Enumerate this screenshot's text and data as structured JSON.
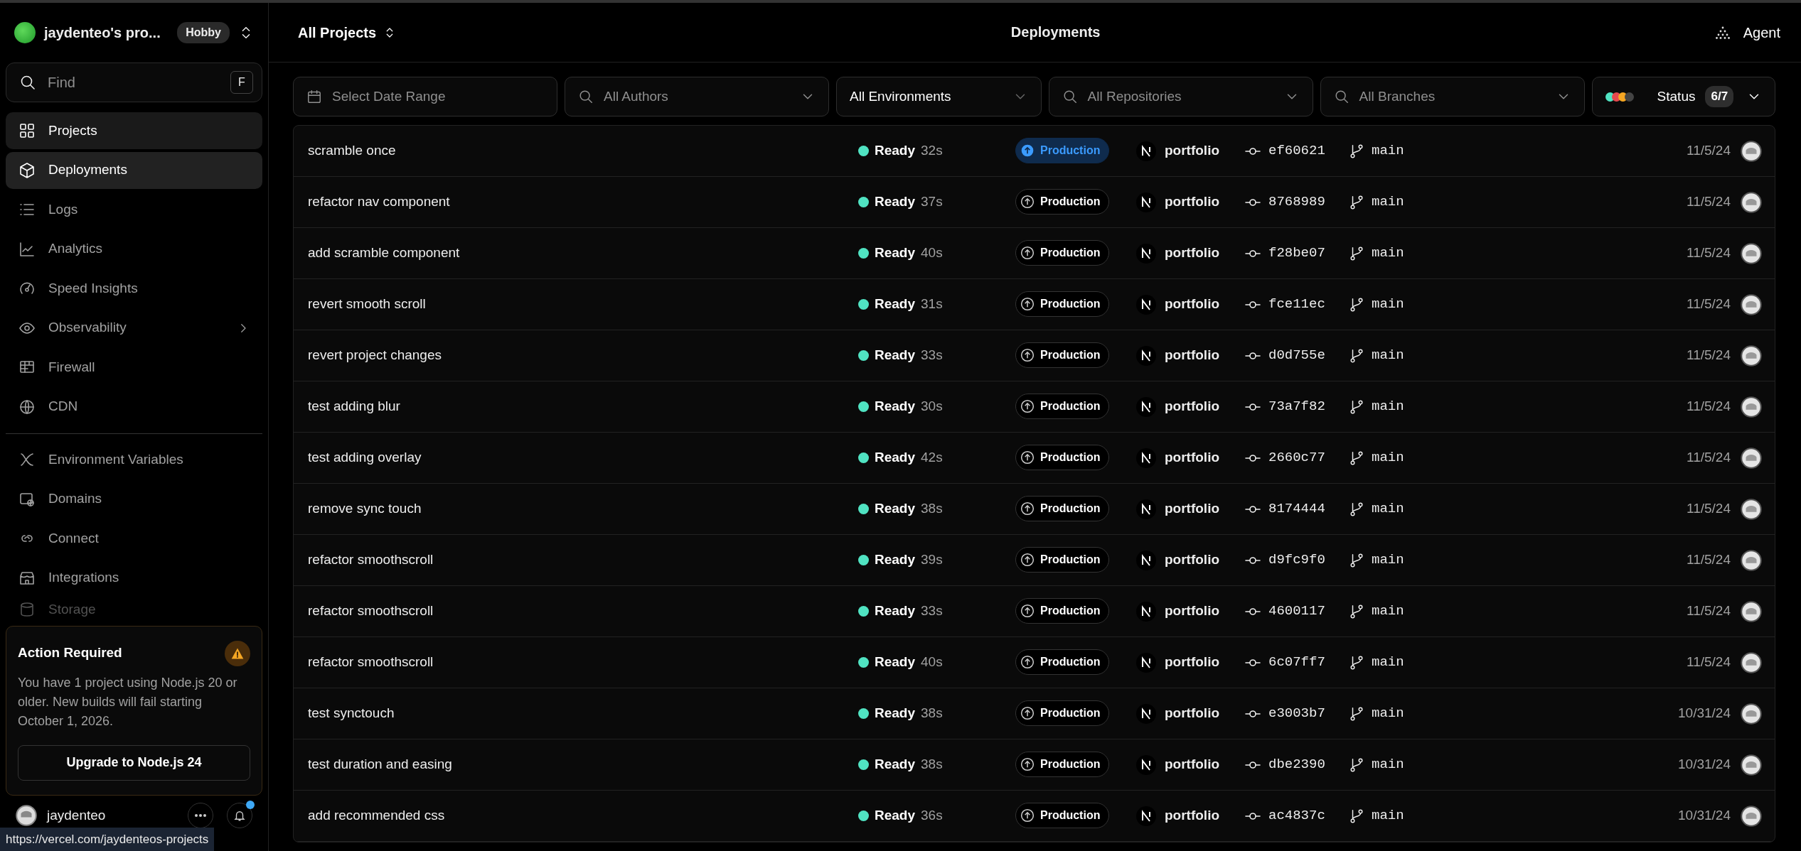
{
  "sidebar": {
    "workspace": "jaydenteo's pro...",
    "plan": "Hobby",
    "search": {
      "placeholder": "Find",
      "shortcut": "F"
    },
    "groups": [
      [
        {
          "label": "Projects",
          "selected": false,
          "hovered": true,
          "has_submenu": false,
          "faded": false
        },
        {
          "label": "Deployments",
          "selected": true,
          "hovered": false,
          "has_submenu": false,
          "faded": false
        },
        {
          "label": "Logs",
          "selected": false,
          "hovered": false,
          "has_submenu": false,
          "faded": false
        },
        {
          "label": "Analytics",
          "selected": false,
          "hovered": false,
          "has_submenu": false,
          "faded": false
        },
        {
          "label": "Speed Insights",
          "selected": false,
          "hovered": false,
          "has_submenu": false,
          "faded": false
        },
        {
          "label": "Observability",
          "selected": false,
          "hovered": false,
          "has_submenu": true,
          "faded": false
        },
        {
          "label": "Firewall",
          "selected": false,
          "hovered": false,
          "has_submenu": false,
          "faded": false
        },
        {
          "label": "CDN",
          "selected": false,
          "hovered": false,
          "has_submenu": false,
          "faded": false
        }
      ],
      [
        {
          "label": "Environment Variables",
          "selected": false,
          "hovered": false,
          "has_submenu": false,
          "faded": false
        },
        {
          "label": "Domains",
          "selected": false,
          "hovered": false,
          "has_submenu": false,
          "faded": false
        },
        {
          "label": "Connect",
          "selected": false,
          "hovered": false,
          "has_submenu": false,
          "faded": false
        },
        {
          "label": "Integrations",
          "selected": false,
          "hovered": false,
          "has_submenu": false,
          "faded": false
        },
        {
          "label": "Storage",
          "selected": false,
          "hovered": false,
          "has_submenu": false,
          "faded": true
        }
      ]
    ],
    "notice": {
      "title": "Action Required",
      "message": "You have 1 project using Node.js 20 or older. New builds will fail starting October 1, 2026.",
      "button": "Upgrade to Node.js 24"
    },
    "user": {
      "name": "jaydenteo",
      "has_notification": true
    },
    "status_link": "https://vercel.com/jaydenteos-projects"
  },
  "header": {
    "project_selector": "All Projects",
    "title": "Deployments",
    "agent": "Agent"
  },
  "filters": [
    {
      "kind": "date",
      "placeholder": "Select Date Range",
      "active": false
    },
    {
      "kind": "search",
      "placeholder": "All Authors",
      "active": false
    },
    {
      "kind": "select",
      "placeholder": "All Environments",
      "active": true
    },
    {
      "kind": "search",
      "placeholder": "All Repositories",
      "active": false
    },
    {
      "kind": "search",
      "placeholder": "All Branches",
      "active": false
    },
    {
      "kind": "status",
      "placeholder": "Status",
      "count": "6/7",
      "dots": [
        {
          "color": "#50e3c2"
        },
        {
          "color": "#e5484d"
        },
        {
          "color": "#f5a623"
        },
        {
          "color": "#444444"
        }
      ]
    }
  ],
  "deployments": [
    {
      "message": "scramble once",
      "status": "Ready",
      "color": "#50e3c2",
      "duration": "32s",
      "environment": "Production",
      "highlighted": true,
      "repo": "portfolio",
      "commit": "ef60621",
      "branch": "main",
      "date": "11/5/24"
    },
    {
      "message": "refactor nav component",
      "status": "Ready",
      "color": "#50e3c2",
      "duration": "37s",
      "environment": "Production",
      "highlighted": false,
      "repo": "portfolio",
      "commit": "8768989",
      "branch": "main",
      "date": "11/5/24"
    },
    {
      "message": "add scramble component",
      "status": "Ready",
      "color": "#50e3c2",
      "duration": "40s",
      "environment": "Production",
      "highlighted": false,
      "repo": "portfolio",
      "commit": "f28be07",
      "branch": "main",
      "date": "11/5/24"
    },
    {
      "message": "revert smooth scroll",
      "status": "Ready",
      "color": "#50e3c2",
      "duration": "31s",
      "environment": "Production",
      "highlighted": false,
      "repo": "portfolio",
      "commit": "fce11ec",
      "branch": "main",
      "date": "11/5/24"
    },
    {
      "message": "revert project changes",
      "status": "Ready",
      "color": "#50e3c2",
      "duration": "33s",
      "environment": "Production",
      "highlighted": false,
      "repo": "portfolio",
      "commit": "d0d755e",
      "branch": "main",
      "date": "11/5/24"
    },
    {
      "message": "test adding blur",
      "status": "Ready",
      "color": "#50e3c2",
      "duration": "30s",
      "environment": "Production",
      "highlighted": false,
      "repo": "portfolio",
      "commit": "73a7f82",
      "branch": "main",
      "date": "11/5/24"
    },
    {
      "message": "test adding overlay",
      "status": "Ready",
      "color": "#50e3c2",
      "duration": "42s",
      "environment": "Production",
      "highlighted": false,
      "repo": "portfolio",
      "commit": "2660c77",
      "branch": "main",
      "date": "11/5/24"
    },
    {
      "message": "remove sync touch",
      "status": "Ready",
      "color": "#50e3c2",
      "duration": "38s",
      "environment": "Production",
      "highlighted": false,
      "repo": "portfolio",
      "commit": "8174444",
      "branch": "main",
      "date": "11/5/24"
    },
    {
      "message": "refactor smoothscroll",
      "status": "Ready",
      "color": "#50e3c2",
      "duration": "39s",
      "environment": "Production",
      "highlighted": false,
      "repo": "portfolio",
      "commit": "d9fc9f0",
      "branch": "main",
      "date": "11/5/24"
    },
    {
      "message": "refactor smoothscroll",
      "status": "Ready",
      "color": "#50e3c2",
      "duration": "33s",
      "environment": "Production",
      "highlighted": false,
      "repo": "portfolio",
      "commit": "4600117",
      "branch": "main",
      "date": "11/5/24"
    },
    {
      "message": "refactor smoothscroll",
      "status": "Ready",
      "color": "#50e3c2",
      "duration": "40s",
      "environment": "Production",
      "highlighted": false,
      "repo": "portfolio",
      "commit": "6c07ff7",
      "branch": "main",
      "date": "11/5/24"
    },
    {
      "message": "test synctouch",
      "status": "Ready",
      "color": "#50e3c2",
      "duration": "38s",
      "environment": "Production",
      "highlighted": false,
      "repo": "portfolio",
      "commit": "e3003b7",
      "branch": "main",
      "date": "10/31/24"
    },
    {
      "message": "test duration and easing",
      "status": "Ready",
      "color": "#50e3c2",
      "duration": "38s",
      "environment": "Production",
      "highlighted": false,
      "repo": "portfolio",
      "commit": "dbe2390",
      "branch": "main",
      "date": "10/31/24"
    },
    {
      "message": "add recommended css",
      "status": "Ready",
      "color": "#50e3c2",
      "duration": "36s",
      "environment": "Production",
      "highlighted": false,
      "repo": "portfolio",
      "commit": "ac4837c",
      "branch": "main",
      "date": "10/31/24"
    }
  ]
}
